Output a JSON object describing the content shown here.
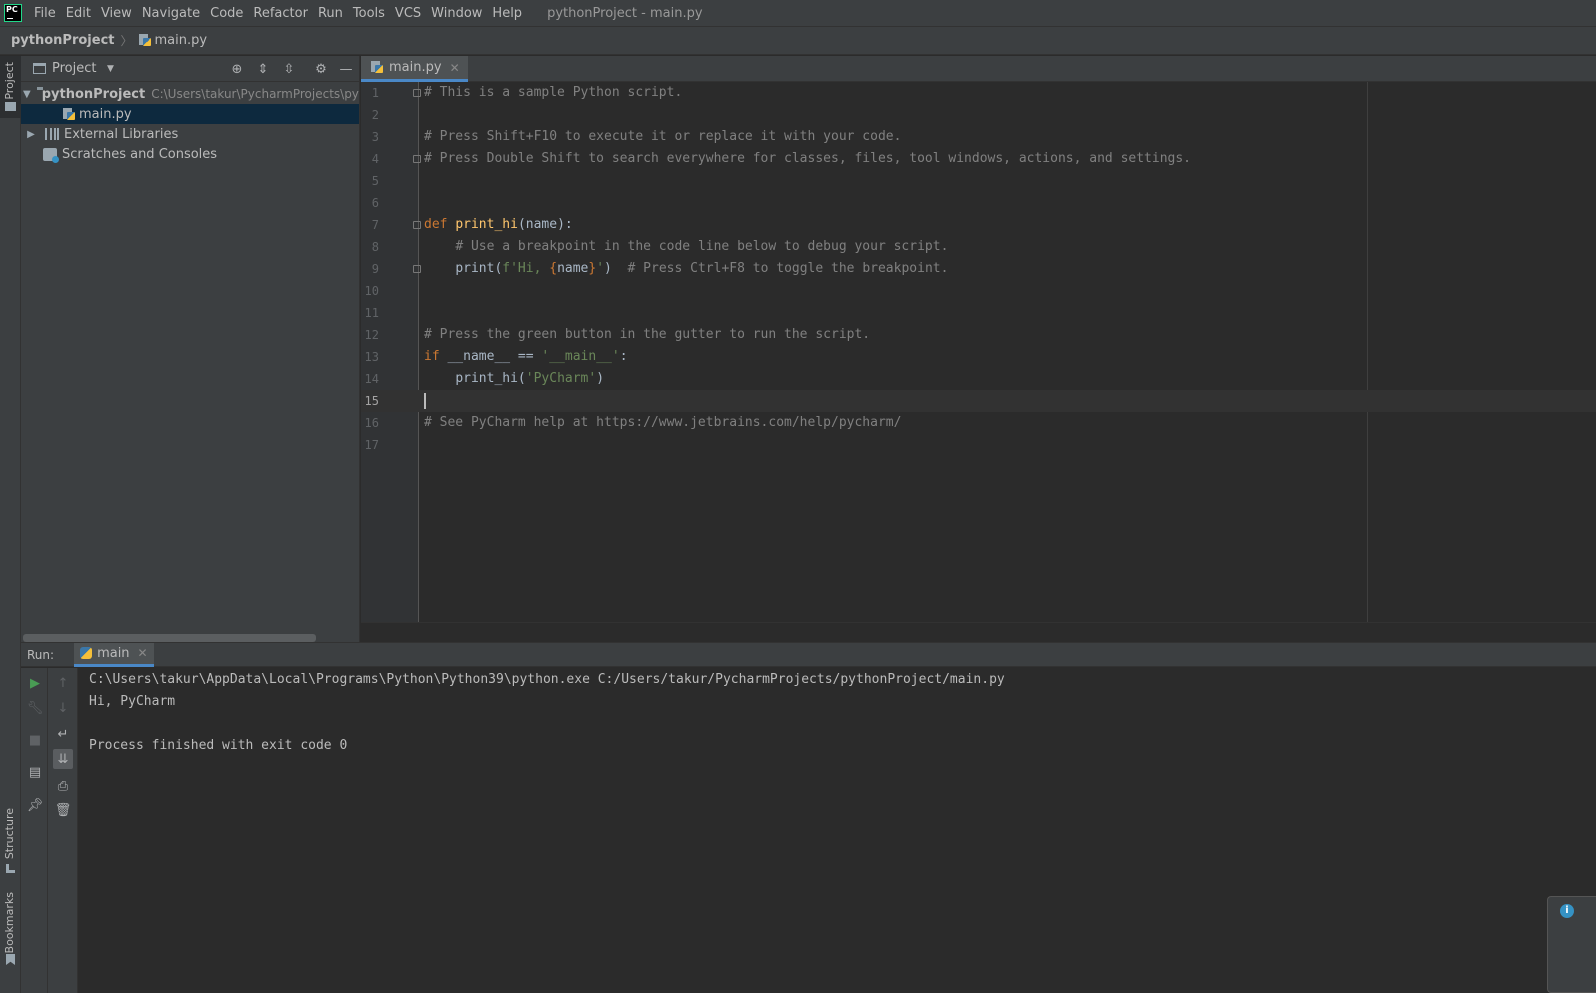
{
  "menubar": {
    "items": [
      "File",
      "Edit",
      "View",
      "Navigate",
      "Code",
      "Refactor",
      "Run",
      "Tools",
      "VCS",
      "Window",
      "Help"
    ],
    "window_title": "pythonProject - main.py"
  },
  "breadcrumb": {
    "project": "pythonProject",
    "file": "main.py"
  },
  "left_strip": {
    "project_tab": "Project",
    "structure_tab": "Structure",
    "bookmarks_tab": "Bookmarks"
  },
  "project_panel": {
    "title": "Project",
    "tree": {
      "root_label": "pythonProject",
      "root_path": "C:\\Users\\takur\\PycharmProjects\\pythonProject",
      "file_label": "main.py",
      "libraries_label": "External Libraries",
      "scratches_label": "Scratches and Consoles"
    }
  },
  "editor": {
    "tab_label": "main.py",
    "current_line": 15,
    "line_numbers": [
      "1",
      "2",
      "3",
      "4",
      "5",
      "6",
      "7",
      "8",
      "9",
      "10",
      "11",
      "12",
      "13",
      "14",
      "15",
      "16",
      "17"
    ],
    "code": {
      "l1": "# This is a sample Python script.",
      "l3": "# Press Shift+F10 to execute it or replace it with your code.",
      "l4": "# Press Double Shift to search everywhere for classes, files, tool windows, actions, and settings.",
      "l7_kw": "def",
      "l7_fn": "print_hi",
      "l7_rest": "(name):",
      "l8": "# Use a breakpoint in the code line below to debug your script.",
      "l9_call": "print(",
      "l9_str_a": "f'Hi, ",
      "l9_brace_open": "{",
      "l9_var": "name",
      "l9_brace_close": "}",
      "l9_str_b": "'",
      "l9_close": ")",
      "l9_comment": "# Press Ctrl+F8 to toggle the breakpoint.",
      "l12": "# Press the green button in the gutter to run the script.",
      "l13_kw": "if",
      "l13_mid": " __name__ == ",
      "l13_str": "'__main__'",
      "l13_end": ":",
      "l14_call": "print_hi(",
      "l14_str": "'PyCharm'",
      "l14_close": ")",
      "l16": "# See PyCharm help at https://www.jetbrains.com/help/pycharm/"
    }
  },
  "run_panel": {
    "label": "Run:",
    "tab_label": "main",
    "console": [
      "C:\\Users\\takur\\AppData\\Local\\Programs\\Python\\Python39\\python.exe C:/Users/takur/PycharmProjects/pythonProject/main.py",
      "Hi, PyCharm",
      "",
      "Process finished with exit code 0"
    ]
  },
  "colors": {
    "accent": "#4a88c7",
    "keyword": "#cc7832",
    "function": "#ffc66d",
    "string": "#6a8759",
    "comment": "#808080",
    "run_green": "#499c54"
  }
}
